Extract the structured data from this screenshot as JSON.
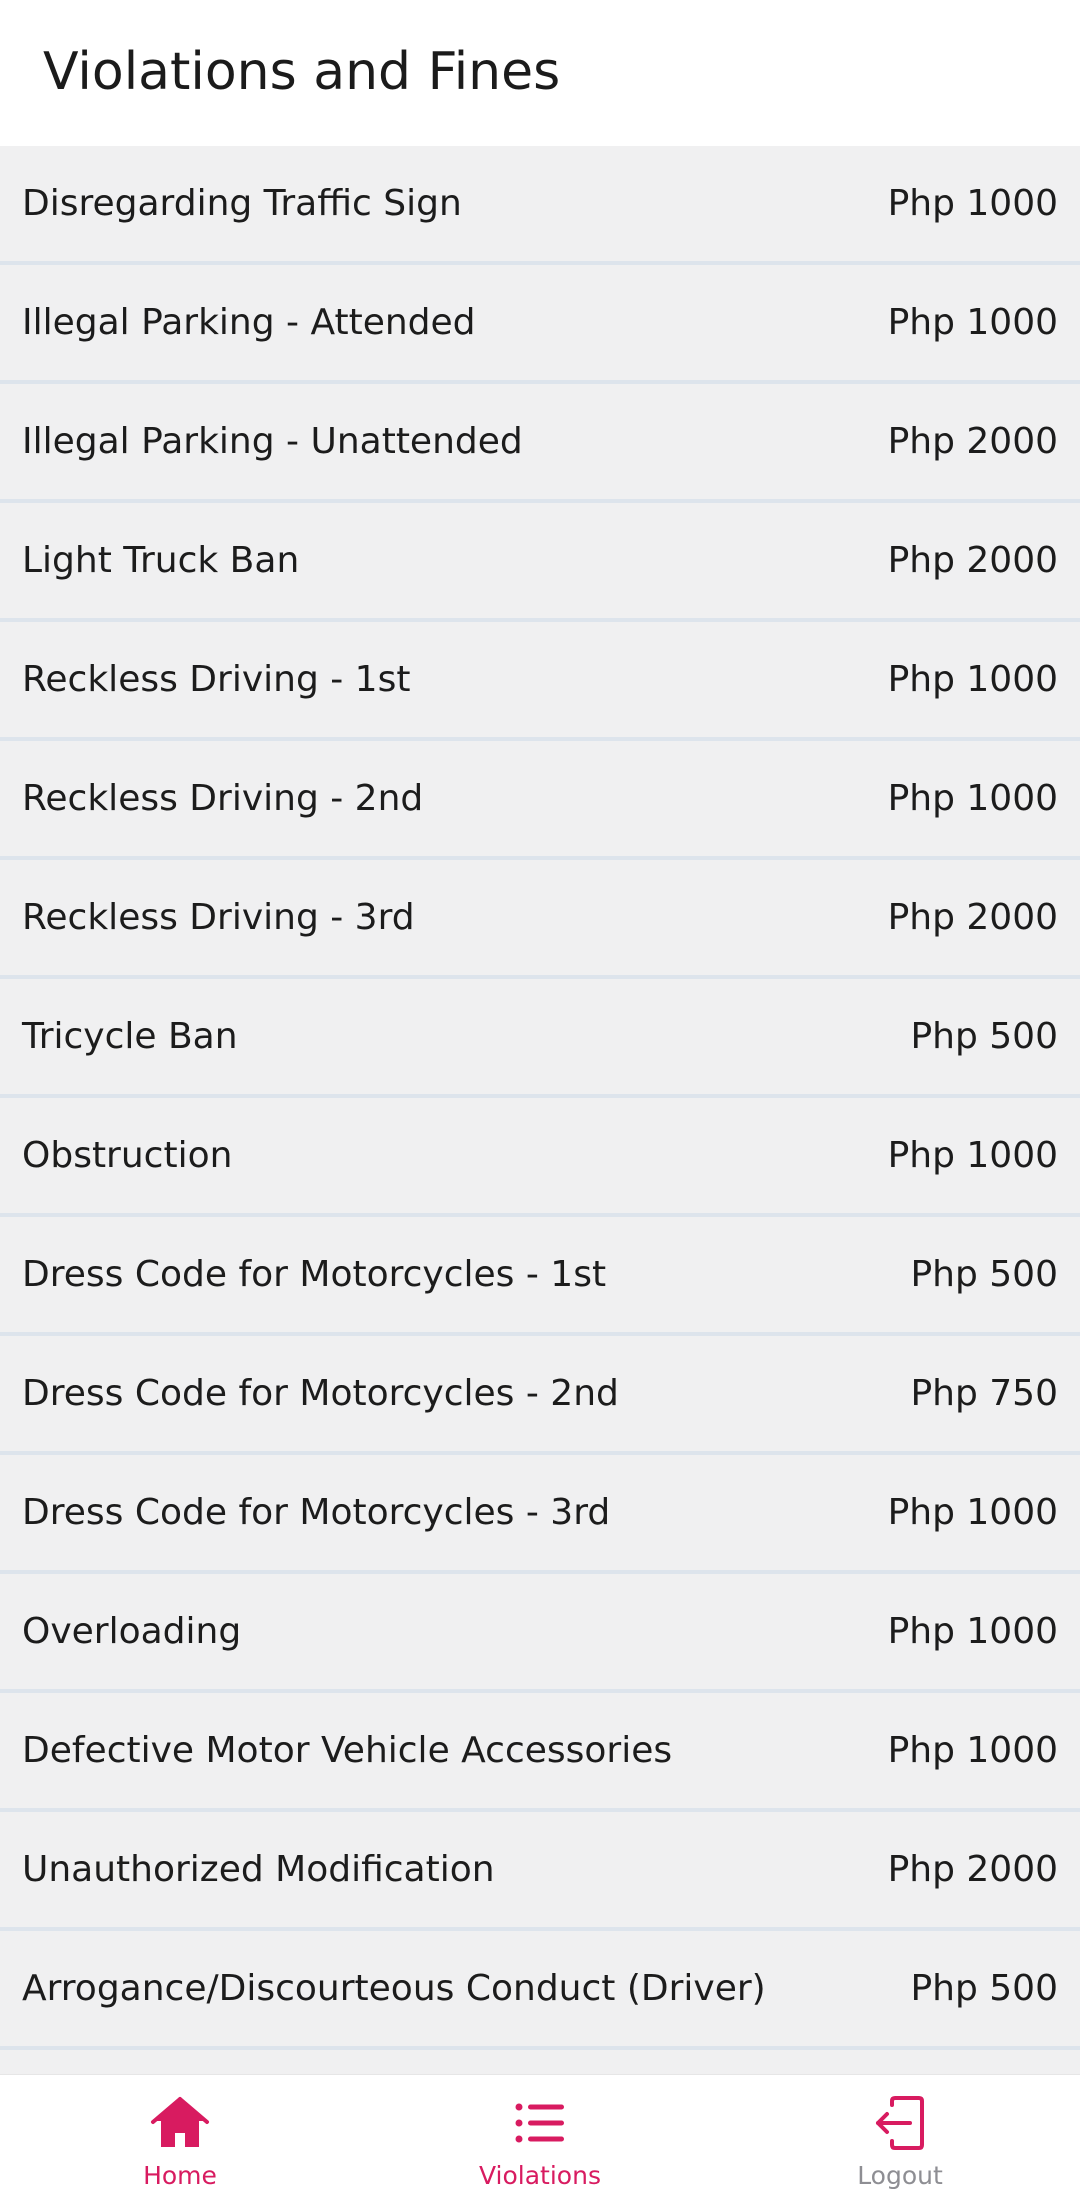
{
  "header": {
    "title": "Violations and Fines"
  },
  "violations": [
    {
      "name": "Disregarding Traffic Sign",
      "fine": "Php 1000"
    },
    {
      "name": "Illegal Parking - Attended",
      "fine": "Php 1000"
    },
    {
      "name": "Illegal Parking - Unattended",
      "fine": "Php 2000"
    },
    {
      "name": "Light Truck Ban",
      "fine": "Php 2000"
    },
    {
      "name": "Reckless Driving - 1st",
      "fine": "Php 1000"
    },
    {
      "name": "Reckless Driving - 2nd",
      "fine": "Php 1000"
    },
    {
      "name": "Reckless Driving - 3rd",
      "fine": "Php 2000"
    },
    {
      "name": "Tricycle Ban",
      "fine": "Php 500"
    },
    {
      "name": "Obstruction",
      "fine": "Php 1000"
    },
    {
      "name": "Dress Code for Motorcycles - 1st",
      "fine": "Php 500"
    },
    {
      "name": "Dress Code for Motorcycles - 2nd",
      "fine": "Php 750"
    },
    {
      "name": "Dress Code for Motorcycles - 3rd",
      "fine": "Php 1000"
    },
    {
      "name": "Overloading",
      "fine": "Php 1000"
    },
    {
      "name": "Defective Motor Vehicle Accessories",
      "fine": "Php 1000"
    },
    {
      "name": "Unauthorized Modification",
      "fine": "Php 2000"
    },
    {
      "name": "Arrogance/Discourteous Conduct (Driver)",
      "fine": "Php 500"
    },
    {
      "name": "",
      "fine": ""
    }
  ],
  "bottom_nav": {
    "active_color": "#d81b60",
    "inactive_color": "#8e8e93",
    "items": [
      {
        "label": "Home",
        "icon": "home-icon",
        "active": true
      },
      {
        "label": "Violations",
        "icon": "list-icon",
        "active": true
      },
      {
        "label": "Logout",
        "icon": "logout-icon",
        "active": false
      }
    ]
  }
}
